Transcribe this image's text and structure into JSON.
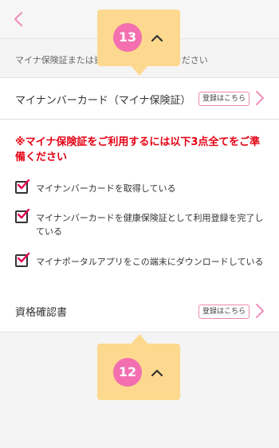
{
  "header": {
    "back_icon": "chevron-left-icon"
  },
  "note": "マイナ保険証または資格確認書をご用意ください",
  "mynacard_row": {
    "title": "マイナンバーカード（マイナ保険証）",
    "badge": "登録はこちら"
  },
  "warning": "※マイナ保険証をご利用するには以下3点全てをご準備ください",
  "checklist": [
    "マイナンバーカードを取得している",
    "マイナンバーカードを健康保険証として利用登録を完了している",
    "マイナポータルアプリをこの端末にダウンロードしている"
  ],
  "certificate_row": {
    "title": "資格確認書",
    "badge": "登録はこちら"
  },
  "callouts": {
    "top": "13",
    "bottom": "12"
  },
  "colors": {
    "accent_pink": "#f36fb0",
    "callout_bg": "#fcd98f",
    "warning_red": "#e60012"
  }
}
